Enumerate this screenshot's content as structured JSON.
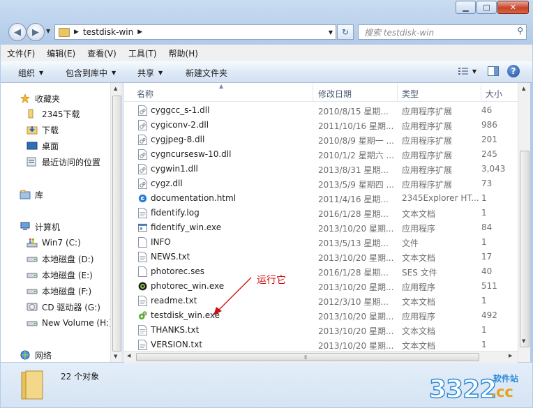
{
  "window": {
    "address_crumb": "testdisk-win",
    "search_placeholder": "搜索 testdisk-win"
  },
  "menu": [
    "文件(F)",
    "编辑(E)",
    "查看(V)",
    "工具(T)",
    "帮助(H)"
  ],
  "commands": [
    "组织",
    "包含到库中",
    "共享",
    "新建文件夹"
  ],
  "nav": {
    "favorites": "收藏夹",
    "favorites_items": [
      "2345下载",
      "下载",
      "桌面",
      "最近访问的位置"
    ],
    "libraries": "库",
    "computer": "计算机",
    "drives": [
      "Win7 (C:)",
      "本地磁盘 (D:)",
      "本地磁盘 (E:)",
      "本地磁盘 (F:)",
      "CD 驱动器 (G:)",
      "New Volume (H:)"
    ],
    "network": "网络"
  },
  "columns": {
    "name": "名称",
    "date": "修改日期",
    "type": "类型",
    "size": "大小"
  },
  "files": [
    {
      "name": "cyggcc_s-1.dll",
      "date": "2010/8/15 星期...",
      "type": "应用程序扩展",
      "size": "46",
      "icon": "dll-icon"
    },
    {
      "name": "cygiconv-2.dll",
      "date": "2011/10/16 星期...",
      "type": "应用程序扩展",
      "size": "986",
      "icon": "dll-icon"
    },
    {
      "name": "cygjpeg-8.dll",
      "date": "2010/8/9 星期一 ...",
      "type": "应用程序扩展",
      "size": "201",
      "icon": "dll-icon"
    },
    {
      "name": "cygncursesw-10.dll",
      "date": "2010/1/2 星期六 ...",
      "type": "应用程序扩展",
      "size": "245",
      "icon": "dll-icon"
    },
    {
      "name": "cygwin1.dll",
      "date": "2013/8/31 星期...",
      "type": "应用程序扩展",
      "size": "3,043",
      "icon": "dll-icon"
    },
    {
      "name": "cygz.dll",
      "date": "2013/5/9 星期四 ...",
      "type": "应用程序扩展",
      "size": "73",
      "icon": "dll-icon"
    },
    {
      "name": "documentation.html",
      "date": "2011/4/16 星期...",
      "type": "2345Explorer HT...",
      "size": "1",
      "icon": "browser-icon"
    },
    {
      "name": "fidentify.log",
      "date": "2016/1/28 星期...",
      "type": "文本文档",
      "size": "1",
      "icon": "text-file-icon"
    },
    {
      "name": "fidentify_win.exe",
      "date": "2013/10/20 星期...",
      "type": "应用程序",
      "size": "84",
      "icon": "exe-icon"
    },
    {
      "name": "INFO",
      "date": "2013/5/13 星期...",
      "type": "文件",
      "size": "1",
      "icon": "blank-file-icon"
    },
    {
      "name": "NEWS.txt",
      "date": "2013/10/20 星期...",
      "type": "文本文档",
      "size": "17",
      "icon": "text-file-icon"
    },
    {
      "name": "photorec.ses",
      "date": "2016/1/28 星期...",
      "type": "SES 文件",
      "size": "40",
      "icon": "blank-file-icon"
    },
    {
      "name": "photorec_win.exe",
      "date": "2013/10/20 星期...",
      "type": "应用程序",
      "size": "511",
      "icon": "photorec-icon"
    },
    {
      "name": "readme.txt",
      "date": "2012/3/10 星期...",
      "type": "文本文档",
      "size": "1",
      "icon": "text-file-icon"
    },
    {
      "name": "testdisk_win.exe",
      "date": "2013/10/20 星期...",
      "type": "应用程序",
      "size": "492",
      "icon": "testdisk-icon"
    },
    {
      "name": "THANKS.txt",
      "date": "2013/10/20 星期...",
      "type": "文本文档",
      "size": "1",
      "icon": "text-file-icon"
    },
    {
      "name": "VERSION.txt",
      "date": "2013/10/20 星期...",
      "type": "文本文档",
      "size": "1",
      "icon": "text-file-icon"
    }
  ],
  "annotation": "运行它",
  "status": {
    "count": "22 个对象"
  },
  "watermark": {
    "number": "3322",
    "top": "软件站",
    "suffix": ".cc"
  },
  "colors": {
    "annotation": "#d01010",
    "watermark_blue": "#2c8bd9",
    "watermark_gold": "#e6a21a"
  }
}
